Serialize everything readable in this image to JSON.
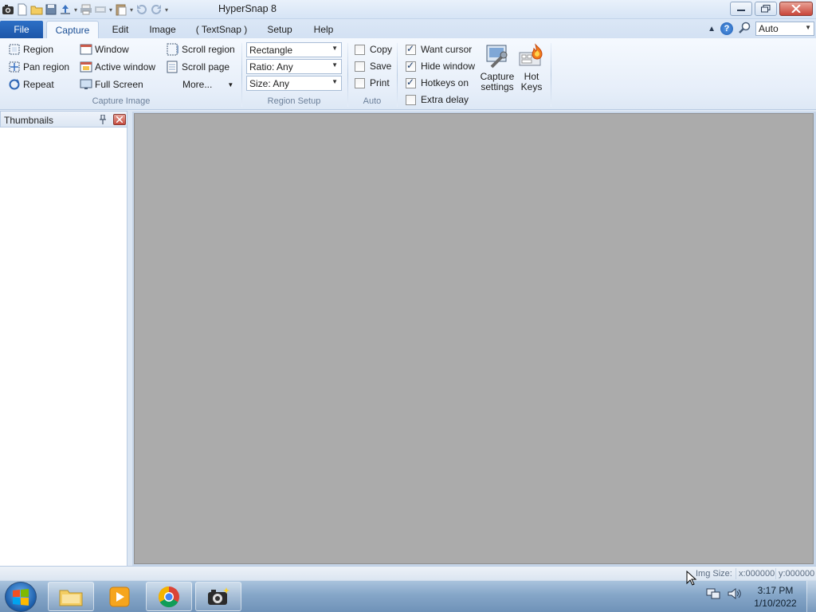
{
  "window": {
    "title": "HyperSnap 8",
    "quick_access_icons": [
      "camera-app-icon",
      "new-icon",
      "open-folder-icon",
      "save-icon",
      "upload-icon",
      "print-icon",
      "print-preview-icon",
      "paste-icon",
      "undo-icon",
      "redo-icon",
      "customize-qat-icon"
    ]
  },
  "tabs": {
    "file": "File",
    "items": [
      "Capture",
      "Edit",
      "Image",
      "( TextSnap )",
      "Setup",
      "Help"
    ],
    "active": "Capture",
    "zoom_value": "Auto"
  },
  "ribbon": {
    "capture_image": {
      "label": "Capture Image",
      "col1": [
        "Region",
        "Pan region",
        "Repeat"
      ],
      "col2": [
        "Window",
        "Active window",
        "Full Screen"
      ],
      "col3": [
        "Scroll region",
        "Scroll page",
        "More..."
      ]
    },
    "region_setup": {
      "label": "Region Setup",
      "shape": "Rectangle",
      "ratio": "Ratio: Any",
      "size": "Size: Any"
    },
    "auto": {
      "label": "Auto",
      "items": [
        {
          "label": "Copy",
          "checked": false
        },
        {
          "label": "Save",
          "checked": false
        },
        {
          "label": "Print",
          "checked": false
        }
      ]
    },
    "options": {
      "items": [
        {
          "label": "Want cursor",
          "checked": true
        },
        {
          "label": "Hide window",
          "checked": true
        },
        {
          "label": "Hotkeys on",
          "checked": true
        },
        {
          "label": "Extra delay",
          "checked": false
        }
      ]
    },
    "capture_settings": {
      "line1": "Capture",
      "line2": "settings"
    },
    "hot_keys": {
      "line1": "Hot",
      "line2": "Keys"
    }
  },
  "thumbnails": {
    "title": "Thumbnails"
  },
  "status": {
    "img_size": "Img Size:",
    "x": "x:000000",
    "y": "y:000000"
  },
  "taskbar": {
    "apps": [
      "windows-explorer-icon",
      "media-player-icon",
      "chrome-icon",
      "hypersnap-icon"
    ],
    "time": "3:17 PM",
    "date": "1/10/2022"
  },
  "colors": {
    "accent": "#1d56a8",
    "canvas": "#ababab",
    "ribbon_bg": "#e6eef9"
  }
}
